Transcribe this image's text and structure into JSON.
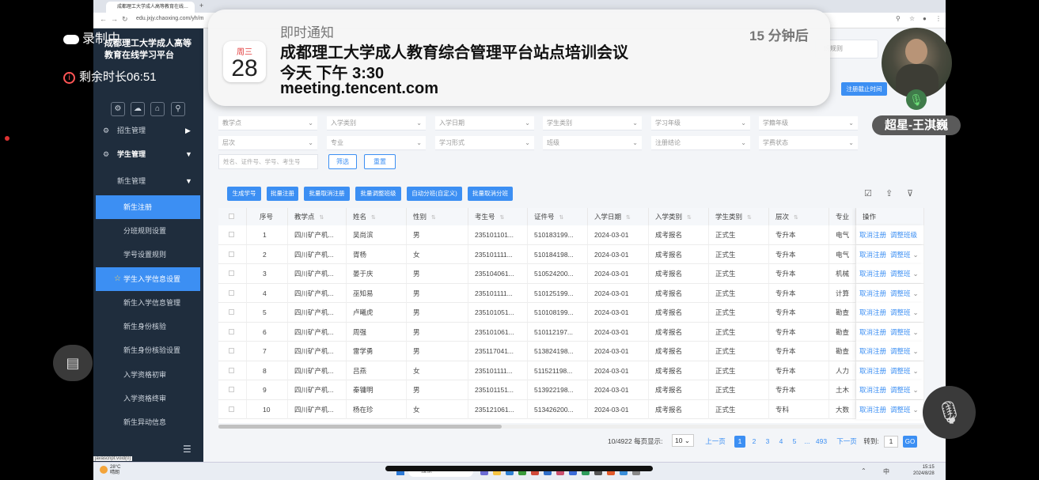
{
  "browser": {
    "tab_title": "成都理工大学成人高等教育在线…",
    "url": "edu.jxjy.chaoxing.com/yh/m",
    "new_tab": "+"
  },
  "recording": {
    "status": "录制中",
    "remaining": "剩余时长06:51"
  },
  "sidebar": {
    "title_line1": "成都理工大学成人高等",
    "title_line2": "教育在线学习平台",
    "menu": [
      {
        "label": "招生管理",
        "type": "group"
      },
      {
        "label": "学生管理",
        "type": "group-open"
      },
      {
        "label": "新生管理",
        "type": "sub-open"
      },
      {
        "label": "新生注册",
        "type": "item",
        "active": true
      },
      {
        "label": "分班规则设置",
        "type": "item"
      },
      {
        "label": "学号设置规则",
        "type": "item"
      },
      {
        "label": "学生入学信息设置",
        "type": "item",
        "hover": true
      },
      {
        "label": "新生入学信息管理",
        "type": "item"
      },
      {
        "label": "新生身份核验",
        "type": "item"
      },
      {
        "label": "新生身份核验设置",
        "type": "item"
      },
      {
        "label": "入学资格初审",
        "type": "item"
      },
      {
        "label": "入学资格终审",
        "type": "item"
      },
      {
        "label": "新生异动信息",
        "type": "item"
      }
    ],
    "status_link": "javascript:void(0)"
  },
  "toolbar_right": {
    "search_placeholder": "班规则",
    "register_deadline_button": "注册截止时间"
  },
  "filters": {
    "row1": [
      "教学点",
      "入学类别",
      "入学日期",
      "学生类别",
      "学习年级",
      "学籍年级"
    ],
    "row2": [
      "层次",
      "专业",
      "学习形式",
      "班级",
      "注册结论",
      "学费状态"
    ],
    "search_placeholder": "姓名、证件号、学号、考生号",
    "filter_button": "筛选",
    "reset_button": "重置"
  },
  "actions": [
    "生成学号",
    "批量注册",
    "批量取消注册",
    "批量调整班级",
    "自动分班(自定义)",
    "批量取消分班"
  ],
  "table": {
    "columns": [
      "序号",
      "教学点",
      "姓名",
      "性别",
      "考生号",
      "证件号",
      "入学日期",
      "入学类别",
      "学生类别",
      "层次",
      "专业",
      "操作"
    ],
    "rows": [
      [
        "1",
        "四川矿产机...",
        "吴尚滨",
        "男",
        "235101101...",
        "510183199...",
        "2024-03-01",
        "成考报名",
        "正式生",
        "专升本",
        "电气"
      ],
      [
        "2",
        "四川矿产机...",
        "胥杨",
        "女",
        "235101111...",
        "510184198...",
        "2024-03-01",
        "成考报名",
        "正式生",
        "专升本",
        "电气"
      ],
      [
        "3",
        "四川矿产机...",
        "晏于庆",
        "男",
        "235104061...",
        "510524200...",
        "2024-03-01",
        "成考报名",
        "正式生",
        "专升本",
        "机械"
      ],
      [
        "4",
        "四川矿产机...",
        "巫知易",
        "男",
        "235101111...",
        "510125199...",
        "2024-03-01",
        "成考报名",
        "正式生",
        "专升本",
        "计算"
      ],
      [
        "5",
        "四川矿产机...",
        "卢曦虎",
        "男",
        "235101051...",
        "510108199...",
        "2024-03-01",
        "成考报名",
        "正式生",
        "专升本",
        "勘查"
      ],
      [
        "6",
        "四川矿产机...",
        "周强",
        "男",
        "235101061...",
        "510112197...",
        "2024-03-01",
        "成考报名",
        "正式生",
        "专升本",
        "勘查"
      ],
      [
        "7",
        "四川矿产机...",
        "雷学勇",
        "男",
        "235117041...",
        "513824198...",
        "2024-03-01",
        "成考报名",
        "正式生",
        "专升本",
        "勘查"
      ],
      [
        "8",
        "四川矿产机...",
        "吕燕",
        "女",
        "235101111...",
        "511521198...",
        "2024-03-01",
        "成考报名",
        "正式生",
        "专升本",
        "人力"
      ],
      [
        "9",
        "四川矿产机...",
        "秦镛明",
        "男",
        "235101151...",
        "513922198...",
        "2024-03-01",
        "成考报名",
        "正式生",
        "专升本",
        "土木"
      ],
      [
        "10",
        "四川矿产机...",
        "杨在珍",
        "女",
        "235121061...",
        "513426200...",
        "2024-03-01",
        "成考报名",
        "正式生",
        "专科",
        "大数"
      ]
    ],
    "op_cancel": "取消注册",
    "op_adjust_first": "调整班级",
    "op_adjust": "调整班"
  },
  "pagination": {
    "summary": "10/4922",
    "per_page_label": "每页显示:",
    "per_page": "10",
    "prev": "上一页",
    "pages": [
      "1",
      "2",
      "3",
      "4",
      "5",
      "...",
      "493"
    ],
    "next": "下一页",
    "goto_label": "转到:",
    "goto_value": "1",
    "go": "GO"
  },
  "notification": {
    "type": "即时通知",
    "time_ago": "15 分钟后",
    "weekday": "周三",
    "day": "28",
    "title": "成都理工大学成人教育综合管理平台站点培训会议",
    "when": "今天 下午 3:30",
    "link": "meeting.tencent.com"
  },
  "participant": {
    "name": "超星-王淇巍"
  },
  "taskbar": {
    "weather_temp": "28°C",
    "weather_desc": "晴朗",
    "search": "搜索",
    "ime_lang": "中",
    "time": "15:15",
    "date": "2024/8/28"
  },
  "colors": {
    "accent": "#3c8ff3",
    "sidebar_bg": "#1f2d3d",
    "page_bg": "#f3f5f8"
  }
}
